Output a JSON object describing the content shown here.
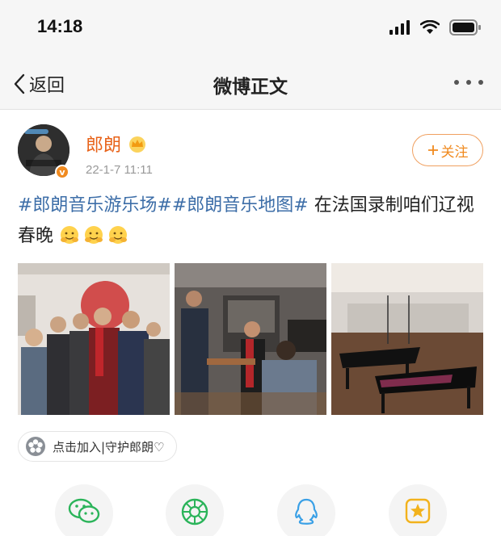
{
  "status_bar": {
    "time": "14:18"
  },
  "nav": {
    "back_label": "返回",
    "title": "微博正文"
  },
  "post": {
    "username": "郎朗",
    "time": "22-1-7 11:11",
    "follow_label": "关注",
    "topic1": "#郎朗音乐游乐场#",
    "topic2": "#郎朗音乐地图#",
    "text": " 在法国录制咱们辽视春晚",
    "emoji_count": 3
  },
  "chip": {
    "label": "点击加入|守护郎朗♡"
  },
  "share": {
    "items": [
      "wechat-icon",
      "moments-icon",
      "qq-icon",
      "qzone-icon"
    ]
  },
  "colors": {
    "accent": "#f08a1f",
    "topic": "#3d6ea8",
    "username": "#e8631a"
  }
}
